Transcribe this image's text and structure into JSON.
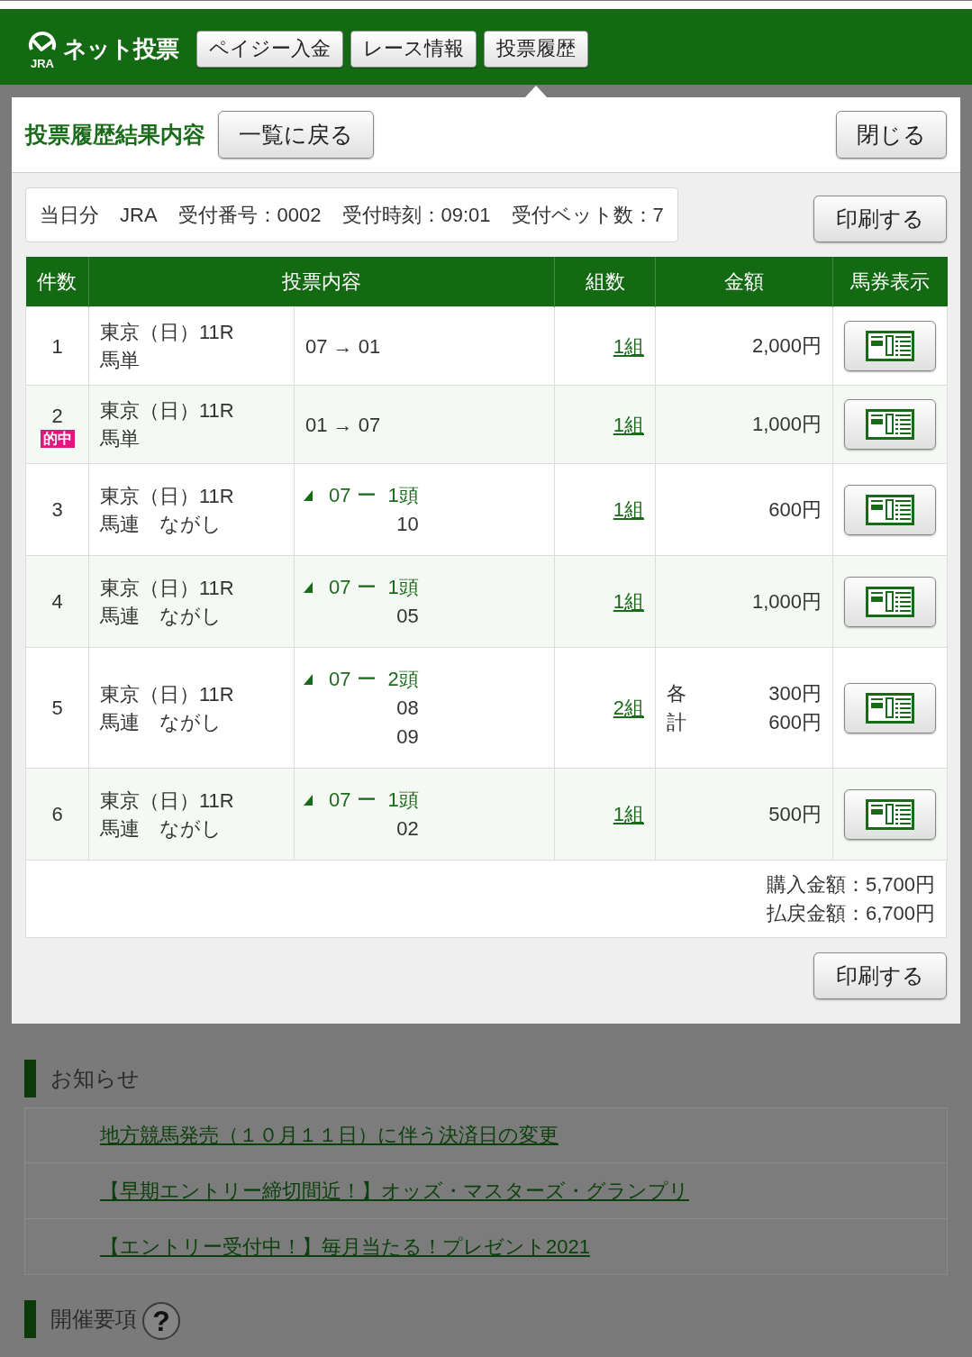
{
  "header": {
    "logo_mark": "JRA",
    "logo_text": "ネット投票",
    "tabs": [
      {
        "label": "ペイジー入金",
        "selected": false
      },
      {
        "label": "レース情報",
        "selected": false
      },
      {
        "label": "投票履歴",
        "selected": true
      }
    ]
  },
  "dialog": {
    "title": "投票履歴結果内容",
    "back_button": "一覧に戻る",
    "close_button": "閉じる",
    "summary": [
      "当日分",
      "JRA",
      "受付番号：0002",
      "受付時刻：09:01",
      "受付ベット数：7"
    ],
    "print_button_top": "印刷する",
    "table": {
      "columns": [
        "件数",
        "投票内容",
        "組数",
        "金額",
        "馬券表示"
      ],
      "rows": [
        {
          "number": "1",
          "race": "東京（日）11R",
          "bet_type": "馬単",
          "selection": {
            "kind": "ordered",
            "text": "07 → 01"
          },
          "combinations": "1組",
          "amounts": [
            {
              "value": "2,000円"
            }
          ]
        },
        {
          "number": "2",
          "badge": "的中",
          "race": "東京（日）11R",
          "bet_type": "馬単",
          "selection": {
            "kind": "ordered",
            "text": "01 → 07"
          },
          "combinations": "1組",
          "amounts": [
            {
              "value": "1,000円"
            }
          ]
        },
        {
          "number": "3",
          "race": "東京（日）11R",
          "bet_type": "馬連　ながし",
          "selection": {
            "kind": "wheel",
            "axis": "07",
            "separator": "ー",
            "count": "1頭",
            "partners": [
              "10"
            ]
          },
          "combinations": "1組",
          "amounts": [
            {
              "value": "600円"
            }
          ]
        },
        {
          "number": "4",
          "race": "東京（日）11R",
          "bet_type": "馬連　ながし",
          "selection": {
            "kind": "wheel",
            "axis": "07",
            "separator": "ー",
            "count": "1頭",
            "partners": [
              "05"
            ]
          },
          "combinations": "1組",
          "amounts": [
            {
              "value": "1,000円"
            }
          ]
        },
        {
          "number": "5",
          "race": "東京（日）11R",
          "bet_type": "馬連　ながし",
          "selection": {
            "kind": "wheel",
            "axis": "07",
            "separator": "ー",
            "count": "2頭",
            "partners": [
              "08",
              "09"
            ]
          },
          "combinations": "2組",
          "amounts": [
            {
              "label": "各",
              "value": "300円"
            },
            {
              "label": "計",
              "value": "600円"
            }
          ]
        },
        {
          "number": "6",
          "race": "東京（日）11R",
          "bet_type": "馬連　ながし",
          "selection": {
            "kind": "wheel",
            "axis": "07",
            "separator": "ー",
            "count": "1頭",
            "partners": [
              "02"
            ]
          },
          "combinations": "1組",
          "amounts": [
            {
              "value": "500円"
            }
          ]
        }
      ]
    },
    "totals": [
      "購入金額：5,700円",
      "払戻金額：6,700円"
    ],
    "print_button_bottom": "印刷する"
  },
  "notices": {
    "title": "お知らせ",
    "items": [
      "地方競馬発売（１０月１１日）に伴う決済日の変更",
      "【早期エントリー締切間近！】オッズ・マスターズ・グランプリ",
      "【エントリー受付中！】毎月当たる！プレゼント2021"
    ]
  },
  "event_info": {
    "title": "開催要項",
    "help": "?"
  }
}
